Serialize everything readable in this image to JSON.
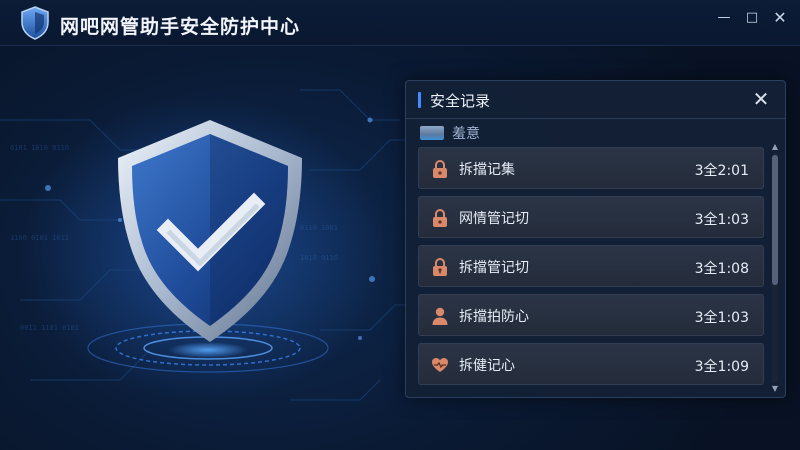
{
  "app": {
    "title": "网吧网管助手安全防护中心"
  },
  "window_controls": {
    "minimize": "—",
    "maximize": "□",
    "close": "✕"
  },
  "panel": {
    "title": "安全记录",
    "close": "✕",
    "section_label": "羞意",
    "records": [
      {
        "icon": "lock-icon",
        "label": "拆擋记集",
        "time": "3全2:01"
      },
      {
        "icon": "lock-icon",
        "label": "网情管记切",
        "time": "3全1:03"
      },
      {
        "icon": "lock-icon",
        "label": "拆擋管记切",
        "time": "3全1:08"
      },
      {
        "icon": "user-icon",
        "label": "拆擋拍防心",
        "time": "3全1:03"
      },
      {
        "icon": "heart-icon",
        "label": "拆健记心",
        "time": "3全1:09"
      }
    ]
  },
  "colors": {
    "accent": "#3f8cff",
    "icon_orange": "#d9886a",
    "background": "#0a1a34"
  }
}
